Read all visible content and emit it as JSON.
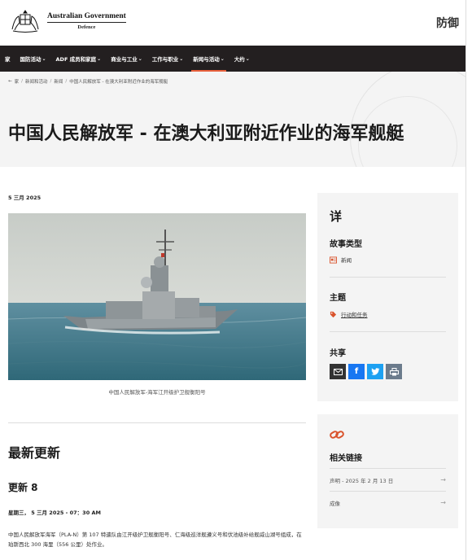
{
  "header": {
    "logo_line1": "Australian Government",
    "logo_line2": "Defence",
    "brand": "防御"
  },
  "nav": {
    "items": [
      {
        "label": "家",
        "chevron": false
      },
      {
        "label": "国防活动",
        "chevron": true
      },
      {
        "label": "ADF 成员和家庭",
        "chevron": true
      },
      {
        "label": "商业与工业",
        "chevron": true
      },
      {
        "label": "工作与职业",
        "chevron": true
      },
      {
        "label": "新闻与活动",
        "chevron": true,
        "active": true
      },
      {
        "label": "大约",
        "chevron": true
      }
    ]
  },
  "breadcrumb": {
    "items": [
      "家",
      "新闻和活动",
      "新闻",
      "中国人民解放军 - 在澳大利亚附近作业的海军舰艇"
    ]
  },
  "page": {
    "title": "中国人民解放军 - 在澳大利亚附近作业的海军舰艇",
    "date": "5 三月 2025",
    "caption": "中国人民解放军-海军江开级护卫舰衡阳号"
  },
  "updates": {
    "title": "最新更新",
    "heading": "更新 8",
    "timestamp": "星期三，  5 三月 2025 - 07：30 AM",
    "body": "中国人民解放军海军（PLA-N）第 107 特遣队由江开级护卫舰衡阳号、仁海级巡洋舰遵义号和伏池级补给舰威山湖号组成，在珀斯西北 300 海里（556 公里）处作业。"
  },
  "details": {
    "title": "详",
    "story_type_label": "故事类型",
    "story_type_value": "新闻",
    "topic_label": "主题",
    "topic_value": "行动和任务",
    "share_label": "共享",
    "share_buttons": [
      "email",
      "facebook",
      "twitter",
      "print"
    ]
  },
  "related": {
    "title": "相关链接",
    "links": [
      "声明 - 2025 年 2 月 13 日",
      "成像"
    ]
  },
  "colors": {
    "nav_bg": "#231f20",
    "accent": "#e8603c",
    "facebook": "#1877f2",
    "twitter": "#1da1f2",
    "email": "#333333",
    "print": "#6b7b8c"
  }
}
